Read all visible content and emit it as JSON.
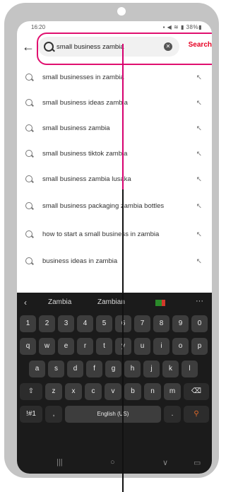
{
  "status": {
    "time": "16:20",
    "icons": "▪ ◀ ≋ ▮ 38%▮"
  },
  "search": {
    "query": "small business zambia",
    "clear_label": "✕",
    "submit_label": "Search",
    "back_label": "←"
  },
  "suggestions": [
    {
      "text": "small businesses in zambia"
    },
    {
      "text": "small business ideas zambia"
    },
    {
      "text": "small business zambia"
    },
    {
      "text": "small business tiktok zambia"
    },
    {
      "text": "small business zambia lusaka"
    },
    {
      "text": "small business packaging zambia bottles"
    },
    {
      "text": "how to start a small business in zambia"
    },
    {
      "text": "business ideas in zambia"
    }
  ],
  "keyboard": {
    "predictions": [
      "Zambia",
      "Zambian"
    ],
    "back": "‹",
    "more": "···",
    "row_numbers": [
      "1",
      "2",
      "3",
      "4",
      "5",
      "6",
      "7",
      "8",
      "9",
      "0"
    ],
    "row1": [
      "q",
      "w",
      "e",
      "r",
      "t",
      "y",
      "u",
      "i",
      "o",
      "p"
    ],
    "row2": [
      "a",
      "s",
      "d",
      "f",
      "g",
      "h",
      "j",
      "k",
      "l"
    ],
    "row3": [
      "z",
      "x",
      "c",
      "v",
      "b",
      "n",
      "m"
    ],
    "shift": "⇧",
    "backspace": "⌫",
    "symbols": "!#1",
    "comma": ",",
    "space": "English (US)",
    "period": ".",
    "search": "⚲"
  },
  "navbar": {
    "recents": "|||",
    "home": "○",
    "back": "∨",
    "keyboard": "▭"
  }
}
